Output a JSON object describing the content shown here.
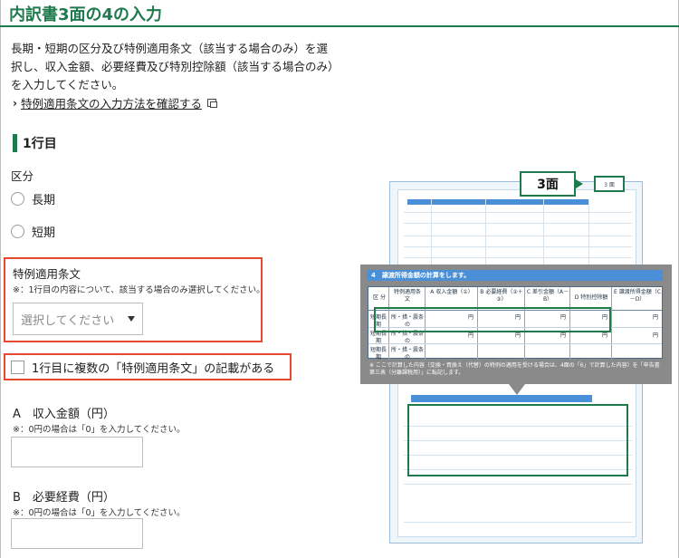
{
  "page": {
    "title": "内訳書3面の4の入力",
    "lead": "長期・短期の区分及び特例適用条文（該当する場合のみ）を選択し、収入金額、必要経費及び特別控除額（該当する場合のみ）を入力してください。",
    "help_link": "特例適用条文の入力方法を確認する"
  },
  "row1": {
    "heading": "1行目",
    "kubun_label": "区分",
    "radio_long": "長期",
    "radio_short": "短期",
    "tokurei_label": "特例適用条文",
    "tokurei_note": "※：1行目の内容について、該当する場合のみ選択してください。",
    "select_placeholder": "選択してください",
    "multi_check_label": "1行目に複数の「特例適用条文」の記載がある",
    "field_a_label": "A　収入金額（円）",
    "field_a_note": "※：0円の場合は「0」を入力してください。",
    "field_b_label": "B　必要経費（円）",
    "field_b_note": "※：0円の場合は「0」を入力してください。"
  },
  "illustration": {
    "callout": "3面",
    "page_mark": "3 面",
    "zoom_header": "4　譲渡所得金額の計算をします。",
    "columns": [
      "区 分",
      "特例適用条　文",
      "A 収入金額（①）",
      "B 必要経費（②＋③）",
      "C 差引金額（A－B）",
      "D 特別控除額",
      "E 譲渡所得金額（C－D）"
    ],
    "row_labels": [
      "短期長期",
      "短期長期",
      "短期長期"
    ],
    "row_article": "所・措・震条の",
    "yen": "円",
    "note": "※ ここで計算した内容（交換・買換え（代替）の特例の適用を受ける場合は、4面の「6」で計算した内容）を「申告書第三表（分離課税用）」に転記します。"
  },
  "colors": {
    "brand_green": "#1f7a4d",
    "highlight_red": "#e54a2e",
    "form_blue": "#4a90d9"
  }
}
